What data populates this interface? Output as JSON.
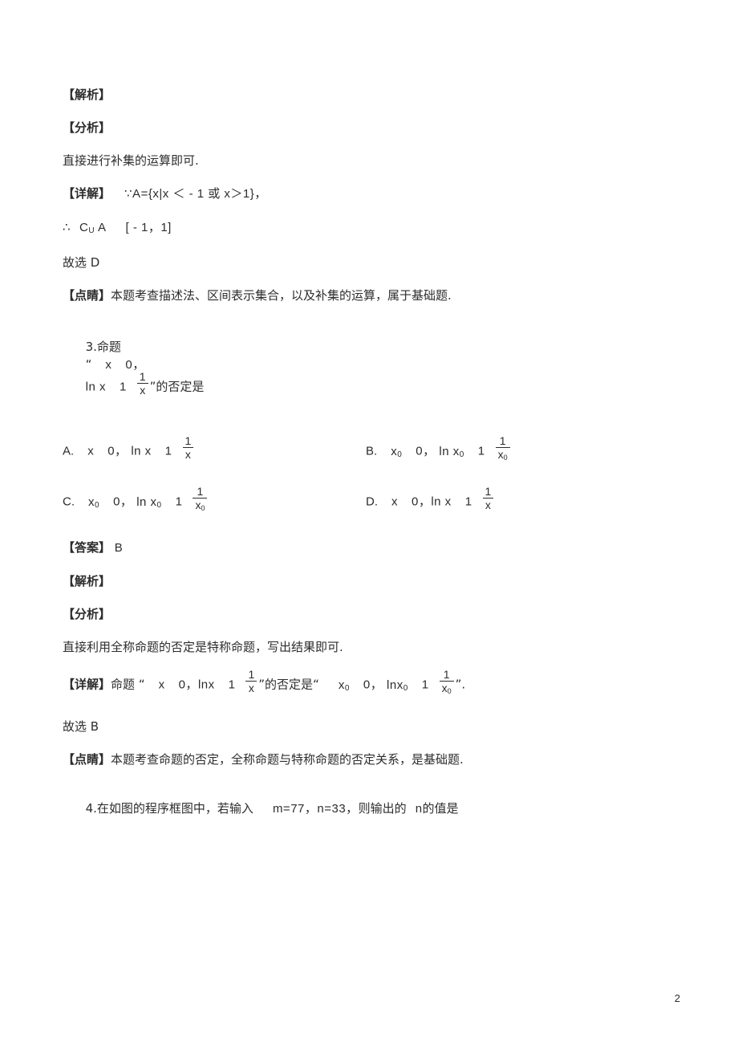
{
  "document": {
    "page_number": "2",
    "background_color": "#ffffff",
    "text_color": "#2d2d2d"
  },
  "blocks": {
    "q2_jiexi_tag": "【解析】",
    "q2_fenxi_tag": "【分析】",
    "q2_fenxi_text": "直接进行补集的运算即可.",
    "q2_xiangjie_tag": "【详解】",
    "q2_xiangjie_text": "∵A={x|x ＜ - 1 或 x＞1}，",
    "q2_conclusion_prefix": "∴",
    "q2_conclusion_c": "C",
    "q2_conclusion_c_sub": "U",
    "q2_conclusion_a": "A",
    "q2_conclusion_interval": "[ - 1，1]",
    "q2_guxuan": "故选 D",
    "q2_dianjing_tag": "【点睛】",
    "q2_dianjing_text": "本题考查描述法、区间表示集合，以及补集的运算，属于基础题.",
    "q3_number": "3.",
    "q3_stem_lead": "命题",
    "q3_quote_open": "“",
    "q3_quote_close": "”",
    "q3_stem_x": "x",
    "q3_stem_zero": "0，",
    "q3_stem_ln": "ln x",
    "q3_stem_one": "1",
    "q3_frac_num": "1",
    "q3_frac_den": "x",
    "q3_stem_tail": "的否定是",
    "q3_choice_a_letter": "A.",
    "q3_choice_b_letter": "B.",
    "q3_choice_c_letter": "C.",
    "q3_choice_d_letter": "D.",
    "q3_var_x": "x",
    "q3_var_x0": "x",
    "q3_var_x0_sub": "0",
    "q3_zero": "0，",
    "q3_ln_x": "ln x",
    "q3_ln_x0": "ln x",
    "q3_one": "1",
    "q3_den_x": "x",
    "q3_den_x0": "x",
    "q3_answer_tag": "【答案】",
    "q3_answer_value": "B",
    "q3_jiexi_tag": "【解析】",
    "q3_fenxi_tag": "【分析】",
    "q3_fenxi_text": "直接利用全称命题的否定是特称命题，写出结果即可.",
    "q3_xiangjie_tag": "【详解】",
    "q3_xiangjie_lead": "命题",
    "q3_xiangjie_ln": "lnx",
    "q3_xiangjie_mid": "的否定是",
    "q3_xiangjie_ln0": "lnx",
    "q3_xiangjie_period": ".",
    "q3_guxuan": "故选 B",
    "q3_dianjing_tag": "【点睛】",
    "q3_dianjing_text": "本题考查命题的否定，全称命题与特称命题的否定关系，是基础题.",
    "q4_number": "4.",
    "q4_text_part1": "在如图的程序框图中，若输入",
    "q4_values": "m=77，n=33，",
    "q4_text_part2": "则输出的",
    "q4_var_n": "n",
    "q4_text_part3": "的值是"
  }
}
